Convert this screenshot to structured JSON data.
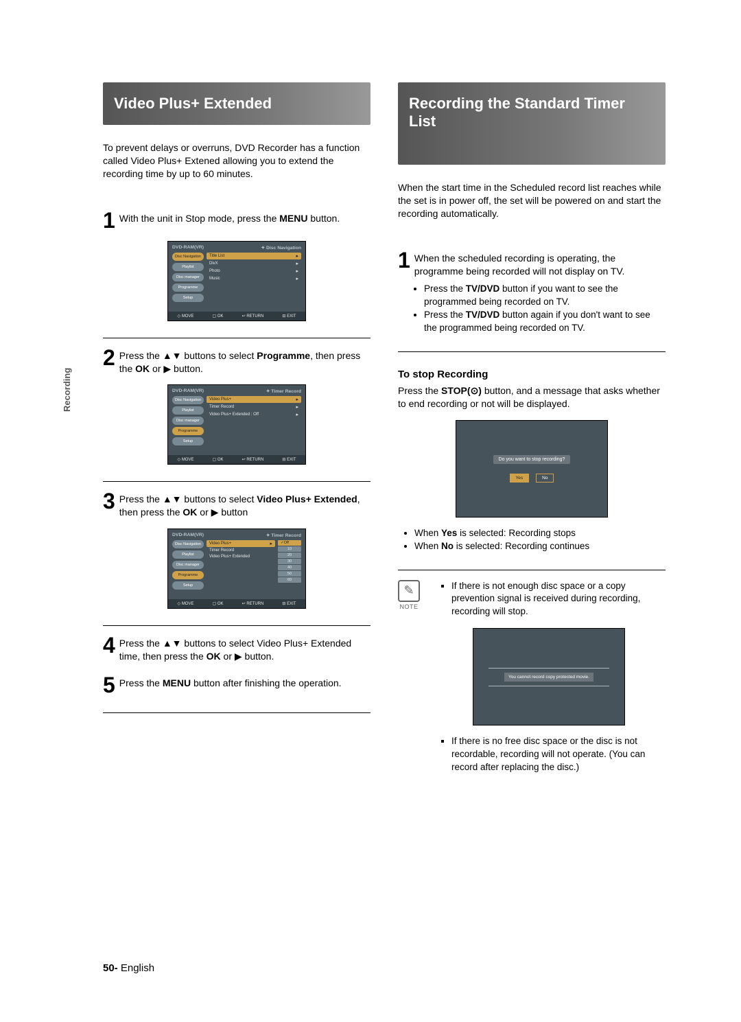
{
  "left": {
    "title": "Video Plus+ Extended",
    "intro": "To prevent delays or overruns, DVD Recorder has a function called Video Plus+ Extened allowing you to extend the recording time by up to 60 minutes.",
    "step1_before": "With the unit in Stop mode, press the ",
    "step1_bold": "MENU",
    "step1_after": " button.",
    "step2_a": "Press the ",
    "step2_b": " buttons to select ",
    "step2_c": "Programme",
    "step2_d": ", then press the ",
    "step2_e": "OK",
    "step2_f": " or ",
    "step2_g": " button.",
    "step3_a": "Press the ",
    "step3_b": " buttons to select ",
    "step3_c": "Video Plus+ Extended",
    "step3_d": ", then press the ",
    "step3_e": "OK",
    "step3_f": " or ",
    "step3_g": " button",
    "step4_a": "Press the ",
    "step4_b": " buttons to select Video Plus+ Extended time, then press the ",
    "step4_c": "OK",
    "step4_d": " or ",
    "step4_e": " button.",
    "step5_a": "Press the ",
    "step5_b": "MENU",
    "step5_c": " button after finishing the operation."
  },
  "right": {
    "title": "Recording the Standard Timer List",
    "intro": "When the start time in the Scheduled record list reaches while the set is in power off, the set will be powered on and start the recording automatically.",
    "step1": "When the scheduled recording is operating, the programme being recorded will not display on TV.",
    "bullet1a": "Press the ",
    "bullet1b": "TV/DVD",
    "bullet1c": " button if you want to see the programmed being recorded on TV.",
    "bullet2a": "Press the ",
    "bullet2b": "TV/DVD",
    "bullet2c": " button again if you don't want to see the programmed being recorded on TV.",
    "stop_head": "To stop Recording",
    "stop_text_a": "Press the ",
    "stop_text_b": "STOP(",
    "stop_text_c": ")",
    "stop_text_d": " button, and a message that asks whether to end recording or not will be displayed.",
    "tv_q": "Do you want to stop recording?",
    "yes": "Yes",
    "no": "No",
    "yesline_a": "When ",
    "yesline_b": "Yes",
    "yesline_c": " is selected: Recording stops",
    "noline_a": "When ",
    "noline_b": "No",
    "noline_c": " is selected: Recording continues",
    "note_label": "NOTE",
    "note1": "If there is not enough disc space or a copy prevention signal is received during recording, recording will stop.",
    "tv_msg2": "You cannot record copy protected movie.",
    "note2": "If there is no free disc space or the disc is not recordable, recording will not operate. (You can record after replacing the disc.)"
  },
  "ui": {
    "dvd_ram": "DVD-RAM(VR)",
    "disc_nav": "Disc Navigation",
    "timer_rec": "Timer Record",
    "side": [
      "Disc Navigation",
      "Playlist",
      "Disc manager",
      "Programme",
      "Setup"
    ],
    "menu1": [
      "Title List",
      "DivX",
      "Photo",
      "Music"
    ],
    "menu2": [
      "Video Plus+",
      "Timer Record",
      "Video Plus+ Extended : Off"
    ],
    "menu3_left": [
      "Video Plus+",
      "Timer Record",
      "Video Plus+ Extended"
    ],
    "opts": [
      "Off",
      "10",
      "20",
      "30",
      "40",
      "50",
      "60"
    ],
    "footer": [
      "MOVE",
      "OK",
      "RETURN",
      "EXIT"
    ]
  },
  "tab": "Recording",
  "page_num": "50-",
  "lang": "English"
}
